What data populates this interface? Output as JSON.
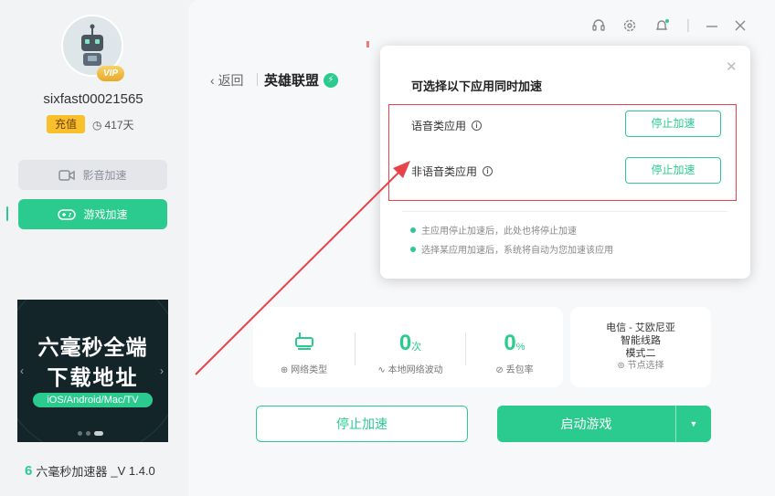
{
  "user": {
    "vip_badge": "VIP",
    "username": "sixfast00021565",
    "recharge_label": "充值",
    "days_remaining": "417天"
  },
  "nav": {
    "video": "影音加速",
    "game": "游戏加速"
  },
  "banner": {
    "line1": "六毫秒全端",
    "line2": "下载地址",
    "platforms": "iOS/Android/Mac/TV"
  },
  "footer": {
    "brand": "六毫秒加速器",
    "version": "_V 1.4.0"
  },
  "header": {
    "back_label": "返回",
    "game_title": "英雄联盟"
  },
  "stats": {
    "network_type_label": "网络类型",
    "jitter_value": "0",
    "jitter_unit": "次",
    "jitter_label": "本地网络波动",
    "loss_value": "0",
    "loss_unit": "%",
    "loss_label": "丢包率"
  },
  "node": {
    "line1": "电信 - 艾欧尼亚",
    "line2": "智能线路",
    "line3": "模式二",
    "select_label": "节点选择"
  },
  "actions": {
    "stop_label": "停止加速",
    "start_label": "启动游戏"
  },
  "popup": {
    "title": "可选择以下应用同时加速",
    "voice_app_label": "语音类应用",
    "voice_app_button": "停止加速",
    "nonvoice_app_label": "非语音类应用",
    "nonvoice_app_button": "停止加速",
    "note1": "主应用停止加速后，此处也将停止加速",
    "note2": "选择某应用加速后，系统将自动为您加速该应用"
  },
  "colors": {
    "accent": "#2bcb8f",
    "highlight": "#e7434a",
    "vip": "#f9c02b"
  },
  "icons": [
    "headset-icon",
    "gear-icon",
    "bell-icon",
    "minimize-icon",
    "close-icon",
    "video-icon",
    "gamepad-icon",
    "clock-icon",
    "bolt-icon",
    "router-icon",
    "globe-icon",
    "wave-icon",
    "link-icon",
    "node-icon",
    "info-icon",
    "caret-down-icon"
  ]
}
